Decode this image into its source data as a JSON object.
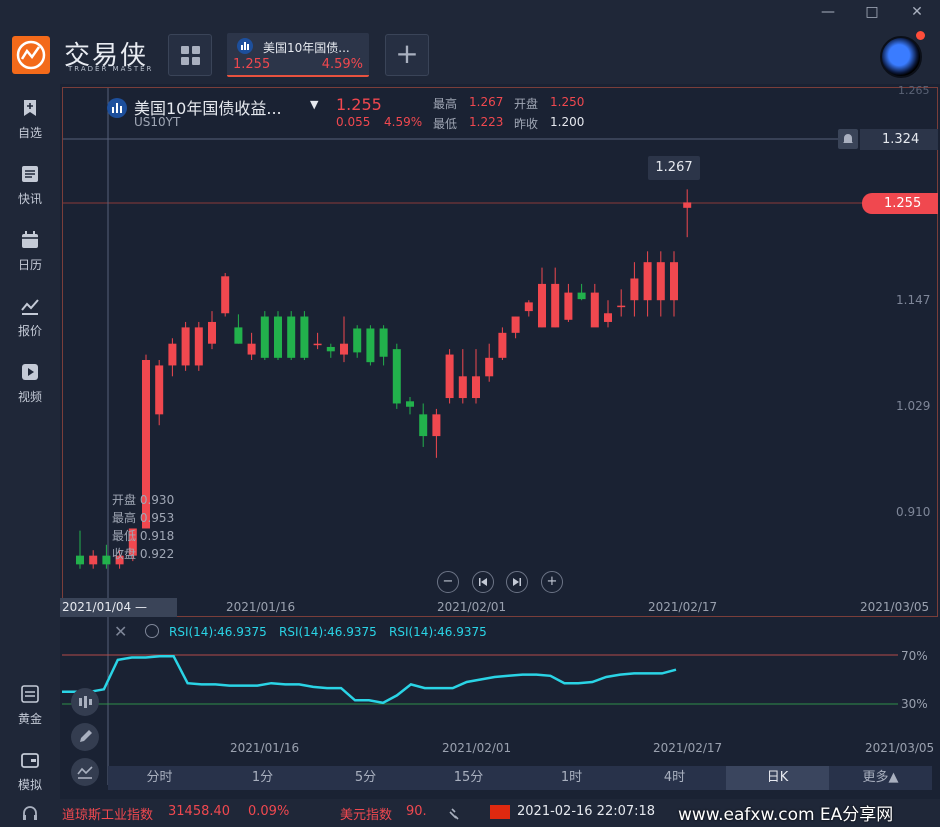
{
  "window": {
    "minimize": "—",
    "maximize": "□",
    "close": "✕"
  },
  "brand": {
    "name": "交易侠",
    "sub": "TRADER MASTER"
  },
  "tab": {
    "name": "美国10年国债...",
    "price": "1.255",
    "pct": "4.59%"
  },
  "add_tab": "+",
  "sidebar": [
    {
      "label": "自选",
      "icon": "bookmark-icon"
    },
    {
      "label": "快讯",
      "icon": "news-icon"
    },
    {
      "label": "日历",
      "icon": "calendar-icon"
    },
    {
      "label": "报价",
      "icon": "quote-icon"
    },
    {
      "label": "视频",
      "icon": "video-icon"
    },
    {
      "label": "黄金",
      "icon": "gold-icon"
    },
    {
      "label": "模拟",
      "icon": "wallet-icon"
    }
  ],
  "symbol": {
    "name": "美国10年国债收益...",
    "arrow": "▼",
    "code": "US10YT",
    "price": "1.255",
    "change": "0.055",
    "pct": "4.59%",
    "high_label": "最高",
    "high": "1.267",
    "open_label": "开盘",
    "open": "1.250",
    "low_label": "最低",
    "low": "1.223",
    "prev_label": "昨收",
    "prev": "1.200"
  },
  "ohlc": {
    "open_label": "开盘",
    "open": "0.930",
    "high_label": "最高",
    "high": "0.953",
    "low_label": "最低",
    "low": "0.918",
    "close_label": "收盘",
    "close": "0.922"
  },
  "price_axis": {
    "ticks": [
      "1.147",
      "1.029",
      "0.910"
    ],
    "alert_level": "1.324",
    "current_tag": "1.255",
    "tooltip": "1.267",
    "top_partial": "1.265"
  },
  "date_axis": {
    "cursor_date": "2021/01/04 —",
    "ticks": [
      "2021/01/16",
      "2021/02/01",
      "2021/02/17",
      "2021/03/05"
    ]
  },
  "rsi": {
    "labels": [
      "RSI(14):46.9375",
      "RSI(14):46.9375",
      "RSI(14):46.9375"
    ],
    "level_high": "70%",
    "level_low": "30%",
    "date_ticks": [
      "2021/01/16",
      "2021/02/01",
      "2021/02/17",
      "2021/03/05"
    ],
    "close": "✕"
  },
  "periods": [
    "分时",
    "1分",
    "5分",
    "15分",
    "1时",
    "4时",
    "日K",
    "更多▲"
  ],
  "active_period": "日K",
  "ticker": {
    "dow_name": "道琼斯工业指数",
    "dow_value": "31458.40",
    "dow_pct": "0.09%",
    "usd_name": "美元指数",
    "usd_value": "90.",
    "datetime": "2021-02-16 22:07:18",
    "watermark": "www.eafxw.com EA分享网"
  },
  "colors": {
    "up": "#f0484f",
    "down": "#22b14c",
    "rsi": "#2ad4e6",
    "accent": "#f36a1a"
  },
  "chart_data": {
    "type": "candlestick",
    "dates_range": [
      "2021/01/04",
      "2021/02/16"
    ],
    "candles": [
      {
        "o": 0.93,
        "h": 0.953,
        "l": 0.918,
        "c": 0.922
      },
      {
        "o": 0.922,
        "h": 0.935,
        "l": 0.918,
        "c": 0.93
      },
      {
        "o": 0.93,
        "h": 0.94,
        "l": 0.918,
        "c": 0.922
      },
      {
        "o": 0.922,
        "h": 0.935,
        "l": 0.918,
        "c": 0.93
      },
      {
        "o": 0.93,
        "h": 0.955,
        "l": 0.925,
        "c": 0.955
      },
      {
        "o": 0.955,
        "h": 1.115,
        "l": 0.955,
        "c": 1.11
      },
      {
        "o": 1.06,
        "h": 1.11,
        "l": 1.05,
        "c": 1.105
      },
      {
        "o": 1.105,
        "h": 1.13,
        "l": 1.095,
        "c": 1.125
      },
      {
        "o": 1.105,
        "h": 1.145,
        "l": 1.1,
        "c": 1.14
      },
      {
        "o": 1.105,
        "h": 1.145,
        "l": 1.1,
        "c": 1.14
      },
      {
        "o": 1.125,
        "h": 1.155,
        "l": 1.12,
        "c": 1.145
      },
      {
        "o": 1.153,
        "h": 1.19,
        "l": 1.15,
        "c": 1.187
      },
      {
        "o": 1.14,
        "h": 1.152,
        "l": 1.125,
        "c": 1.125
      },
      {
        "o": 1.115,
        "h": 1.135,
        "l": 1.11,
        "c": 1.125
      },
      {
        "o": 1.15,
        "h": 1.155,
        "l": 1.11,
        "c": 1.112
      },
      {
        "o": 1.15,
        "h": 1.155,
        "l": 1.11,
        "c": 1.112
      },
      {
        "o": 1.15,
        "h": 1.155,
        "l": 1.11,
        "c": 1.112
      },
      {
        "o": 1.15,
        "h": 1.155,
        "l": 1.11,
        "c": 1.112
      },
      {
        "o": 1.125,
        "h": 1.135,
        "l": 1.12,
        "c": 1.125
      },
      {
        "o": 1.122,
        "h": 1.125,
        "l": 1.112,
        "c": 1.118
      },
      {
        "o": 1.115,
        "h": 1.15,
        "l": 1.108,
        "c": 1.125
      },
      {
        "o": 1.139,
        "h": 1.142,
        "l": 1.112,
        "c": 1.117
      },
      {
        "o": 1.139,
        "h": 1.142,
        "l": 1.105,
        "c": 1.108
      },
      {
        "o": 1.139,
        "h": 1.142,
        "l": 1.105,
        "c": 1.113
      },
      {
        "o": 1.12,
        "h": 1.125,
        "l": 1.065,
        "c": 1.07
      },
      {
        "o": 1.072,
        "h": 1.076,
        "l": 1.06,
        "c": 1.067
      },
      {
        "o": 1.06,
        "h": 1.07,
        "l": 1.03,
        "c": 1.04
      },
      {
        "o": 1.04,
        "h": 1.065,
        "l": 1.02,
        "c": 1.06
      },
      {
        "o": 1.075,
        "h": 1.12,
        "l": 1.07,
        "c": 1.115
      },
      {
        "o": 1.075,
        "h": 1.12,
        "l": 1.07,
        "c": 1.095
      },
      {
        "o": 1.075,
        "h": 1.12,
        "l": 1.07,
        "c": 1.095
      },
      {
        "o": 1.095,
        "h": 1.125,
        "l": 1.09,
        "c": 1.112
      },
      {
        "o": 1.112,
        "h": 1.14,
        "l": 1.11,
        "c": 1.135
      },
      {
        "o": 1.135,
        "h": 1.15,
        "l": 1.13,
        "c": 1.15
      },
      {
        "o": 1.155,
        "h": 1.165,
        "l": 1.15,
        "c": 1.163
      },
      {
        "o": 1.14,
        "h": 1.195,
        "l": 1.14,
        "c": 1.18
      },
      {
        "o": 1.14,
        "h": 1.195,
        "l": 1.14,
        "c": 1.18
      },
      {
        "o": 1.147,
        "h": 1.18,
        "l": 1.145,
        "c": 1.172
      },
      {
        "o": 1.172,
        "h": 1.18,
        "l": 1.165,
        "c": 1.166
      },
      {
        "o": 1.14,
        "h": 1.18,
        "l": 1.145,
        "c": 1.172
      },
      {
        "o": 1.145,
        "h": 1.165,
        "l": 1.14,
        "c": 1.153
      },
      {
        "o": 1.16,
        "h": 1.175,
        "l": 1.15,
        "c": 1.16
      },
      {
        "o": 1.165,
        "h": 1.2,
        "l": 1.15,
        "c": 1.185
      },
      {
        "o": 1.165,
        "h": 1.21,
        "l": 1.15,
        "c": 1.2
      },
      {
        "o": 1.165,
        "h": 1.21,
        "l": 1.15,
        "c": 1.2
      },
      {
        "o": 1.165,
        "h": 1.21,
        "l": 1.15,
        "c": 1.2
      },
      {
        "o": 1.25,
        "h": 1.267,
        "l": 1.223,
        "c": 1.255
      }
    ],
    "rsi_values": [
      40,
      40,
      40,
      42,
      66,
      68,
      68,
      69,
      69,
      47,
      46,
      46,
      45,
      45,
      45,
      47,
      46,
      46,
      44,
      43,
      43,
      33,
      33,
      31,
      37,
      46,
      43,
      43,
      43,
      48,
      50,
      52,
      53,
      54,
      54,
      53,
      47,
      47,
      48,
      52,
      54,
      55,
      55,
      55,
      58
    ],
    "rsi_levels": [
      70,
      30
    ],
    "price_ylim": [
      0.88,
      1.34
    ]
  }
}
